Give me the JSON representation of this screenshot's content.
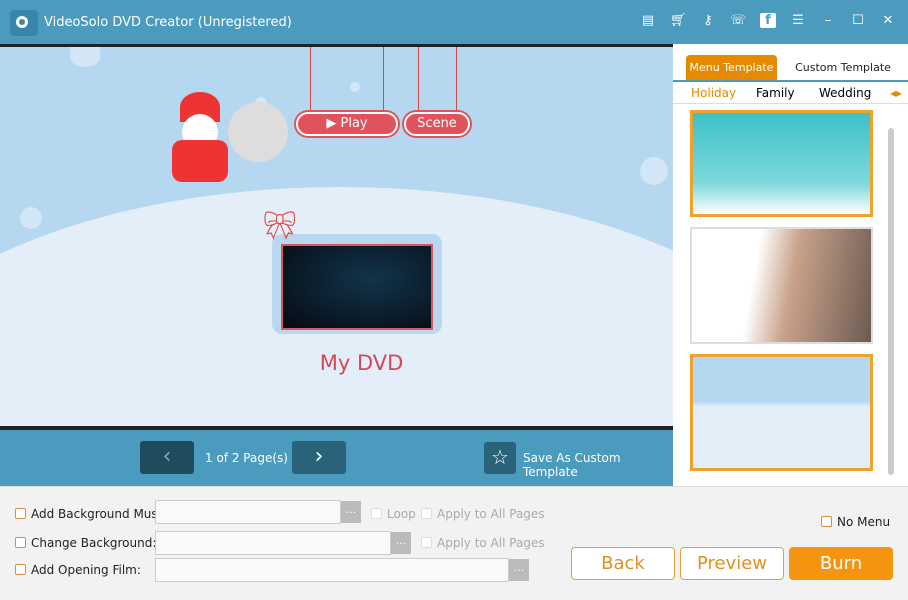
{
  "app": {
    "title": "VideoSolo DVD Creator (Unregistered)"
  },
  "title_icons": [
    "document-icon",
    "cart-icon",
    "key-icon",
    "support-icon",
    "facebook-icon",
    "feedback-icon",
    "minimize-icon",
    "maximize-icon",
    "close-icon"
  ],
  "menu_preview": {
    "play_label": "Play",
    "scene_label": "Scene",
    "dvd_title": "My DVD"
  },
  "nav": {
    "prev": "‹",
    "next": "›",
    "page_info": "1 of 2 Page(s)",
    "save_template": "Save As Custom Template"
  },
  "panel": {
    "tabs": [
      "Menu Template",
      "Custom Template"
    ],
    "categories": [
      "Holiday",
      "Family",
      "Wedding"
    ],
    "selected_category": "Holiday",
    "selected_thumbnail": 3
  },
  "options": {
    "bg_music": {
      "label": "Add Background Music:",
      "value": "",
      "loop": "Loop",
      "apply_all": "Apply to All Pages"
    },
    "change_bg": {
      "label": "Change Background:",
      "value": "",
      "apply_all": "Apply to All Pages"
    },
    "opening_film": {
      "label": "Add Opening Film:",
      "value": ""
    },
    "browse": "...",
    "no_menu": "No Menu"
  },
  "actions": {
    "back": "Back",
    "preview": "Preview",
    "burn": "Burn"
  },
  "colors": {
    "accent": "#f5950f",
    "titlebar": "#4b9bbf"
  }
}
